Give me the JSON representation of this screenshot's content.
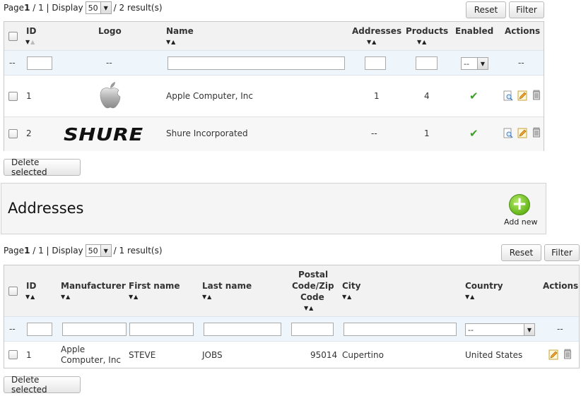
{
  "manufacturers": {
    "pager": {
      "page_label": "Page",
      "page_current": "1",
      "page_total": "/ 1 | Display",
      "display_value": "50",
      "results": "/ 2 result(s)"
    },
    "buttons": {
      "reset": "Reset",
      "filter": "Filter",
      "delete_selected": "Delete selected"
    },
    "columns": {
      "id": "ID",
      "logo": "Logo",
      "name": "Name",
      "addresses": "Addresses",
      "products": "Products",
      "enabled": "Enabled",
      "actions": "Actions"
    },
    "filter": {
      "dash": "--",
      "enabled_select": "--"
    },
    "rows": [
      {
        "id": "1",
        "logo": "apple-logo",
        "name": "Apple Computer, Inc",
        "addresses": "1",
        "products": "4",
        "enabled": true
      },
      {
        "id": "2",
        "logo": "SHURE",
        "name": "Shure Incorporated",
        "addresses": "--",
        "products": "1",
        "enabled": true
      }
    ]
  },
  "addresses_panel": {
    "title": "Addresses",
    "add_new": "Add new"
  },
  "addresses": {
    "pager": {
      "page_label": "Page",
      "page_current": "1",
      "page_total": "/ 1 | Display",
      "display_value": "50",
      "results": "/ 1 result(s)"
    },
    "buttons": {
      "reset": "Reset",
      "filter": "Filter",
      "delete_selected": "Delete selected"
    },
    "columns": {
      "id": "ID",
      "manufacturer": "Manufacturer",
      "first_name": "First name",
      "last_name": "Last name",
      "postal_1": "Postal",
      "postal_2": "Code/Zip",
      "postal_3": "Code",
      "city": "City",
      "country": "Country",
      "actions": "Actions"
    },
    "filter": {
      "dash": "--",
      "country_select": "--"
    },
    "rows": [
      {
        "id": "1",
        "manufacturer_1": "Apple",
        "manufacturer_2": "Computer, Inc",
        "first_name": "STEVE",
        "last_name": "JOBS",
        "postal": "95014",
        "city": "Cupertino",
        "country": "United States"
      }
    ]
  },
  "colors": {
    "accent_green": "#6cbb1f",
    "check_green": "#3f9e2a",
    "filter_row": "#eef5fb"
  }
}
